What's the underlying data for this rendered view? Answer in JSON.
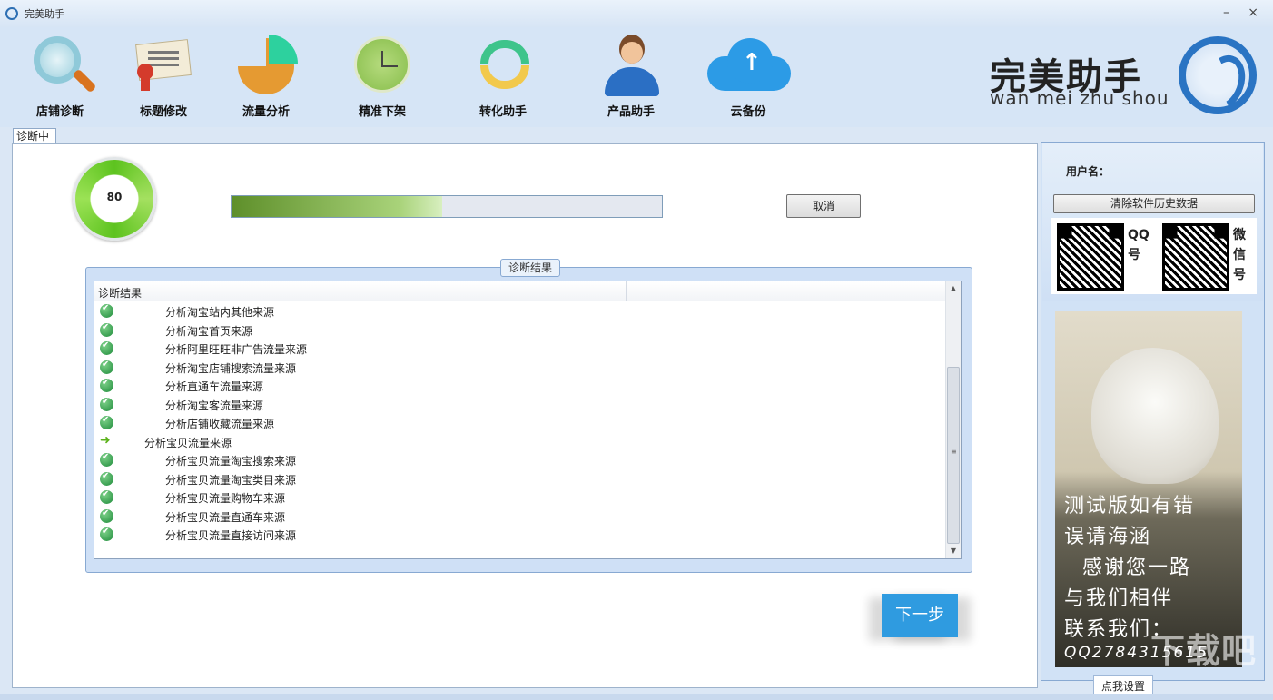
{
  "window": {
    "title": "完美助手",
    "minimize": "–",
    "close": "×"
  },
  "toolbar": {
    "items": [
      {
        "label": "店铺诊断",
        "icon": "magnifier-icon"
      },
      {
        "label": "标题修改",
        "icon": "certificate-icon"
      },
      {
        "label": "流量分析",
        "icon": "pie-chart-icon"
      },
      {
        "label": "精准下架",
        "icon": "clock-icon"
      },
      {
        "label": "转化助手",
        "icon": "refresh-arrows-icon"
      },
      {
        "label": "产品助手",
        "icon": "user-icon"
      },
      {
        "label": "云备份",
        "icon": "cloud-upload-icon"
      }
    ]
  },
  "logo": {
    "cn": "完美助手",
    "en": "wan mei zhu shou"
  },
  "tab": {
    "label": "诊断中"
  },
  "score": {
    "value": "80"
  },
  "progress": {
    "percent": 49
  },
  "cancel_label": "取消",
  "results": {
    "group_title": "诊断结果",
    "column_header": "诊断结果",
    "rows": [
      {
        "status": "done",
        "level": 2,
        "text": "分析淘宝站内其他来源"
      },
      {
        "status": "done",
        "level": 2,
        "text": "分析淘宝首页来源"
      },
      {
        "status": "done",
        "level": 2,
        "text": "分析阿里旺旺非广告流量来源"
      },
      {
        "status": "done",
        "level": 2,
        "text": "分析淘宝店铺搜索流量来源"
      },
      {
        "status": "done",
        "level": 2,
        "text": "分析直通车流量来源"
      },
      {
        "status": "done",
        "level": 2,
        "text": "分析淘宝客流量来源"
      },
      {
        "status": "done",
        "level": 2,
        "text": "分析店铺收藏流量来源"
      },
      {
        "status": "current",
        "level": 1,
        "text": "分析宝贝流量来源"
      },
      {
        "status": "done",
        "level": 2,
        "text": "分析宝贝流量淘宝搜索来源"
      },
      {
        "status": "done",
        "level": 2,
        "text": "分析宝贝流量淘宝类目来源"
      },
      {
        "status": "done",
        "level": 2,
        "text": "分析宝贝流量购物车来源"
      },
      {
        "status": "done",
        "level": 2,
        "text": "分析宝贝流量直通车来源"
      },
      {
        "status": "done",
        "level": 2,
        "text": "分析宝贝流量直接访问来源"
      }
    ]
  },
  "next_label": "下一步",
  "side": {
    "user_label": "用户名：",
    "user_value": "",
    "clear_label": "清除软件历史数据",
    "qq_label": "QQ号",
    "wechat_label": "微信号",
    "ad_lines": [
      "测试版如有错",
      "误请海涵",
      "感谢您一路",
      "与我们相伴",
      "联系我们：",
      "QQ2784315615"
    ]
  },
  "settings_tab": "点我设置",
  "watermark": "下载吧"
}
